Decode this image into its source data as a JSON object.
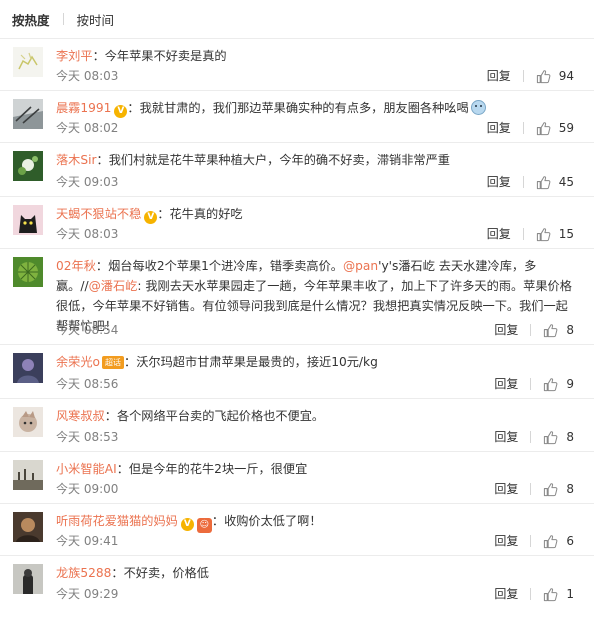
{
  "tabs": {
    "hot": "按热度",
    "time": "按时间"
  },
  "reply_label": "回复",
  "comments": [
    {
      "user": "李刘平",
      "colon": "：",
      "text": "今年苹果不好卖是真的",
      "time": "今天 08:03",
      "likes": "94"
    },
    {
      "user": "晨霧1991",
      "colon": "：",
      "text": "我就甘肃的，我们那边苹果确实种的有点多，朋友圈各种吆喝",
      "time": "今天 08:02",
      "likes": "59"
    },
    {
      "user": "落木Sir",
      "colon": "：",
      "text": "我们村就是花牛苹果种植大户，今年的确不好卖，滞销非常严重",
      "time": "今天 09:03",
      "likes": "45"
    },
    {
      "user": "天蝎不狠站不稳",
      "colon": "：",
      "text": "花牛真的好吃",
      "time": "今天 08:03",
      "likes": "15"
    },
    {
      "user": "02年秋",
      "colon": "：",
      "text_a": "烟台每收2个苹果1个进冷库，错季卖高价。",
      "mention_1": "@pan",
      "text_b": "'y's潘石屹 去天水建冷库，多赢。//",
      "mention_2": "@潘石屹",
      "text_c": ": 我刚去天水苹果园走了一趟，今年苹果丰收了，加上下了许多天的雨。苹果价格很低，今年苹果不好销售。有位领导问我到底是什么情况？我想把真实情况反映一下。我们一起帮帮忙吧！",
      "time": "今天 08:54",
      "likes": "8"
    },
    {
      "user": "余荣光o",
      "tag": "超话",
      "colon": "：",
      "text": "沃尔玛超市甘肃苹果是最贵的，接近10元/kg",
      "time": "今天 08:56",
      "likes": "9"
    },
    {
      "user": "风寒叔叔",
      "colon": "：",
      "text": "各个网络平台卖的飞起价格也不便宜。",
      "time": "今天 08:53",
      "likes": "8"
    },
    {
      "user": "小米智能AI",
      "colon": "：",
      "text": "但是今年的花牛2块一斤，很便宜",
      "time": "今天 09:00",
      "likes": "8"
    },
    {
      "user": "听雨荷花爱猫猫的妈妈",
      "colon": "：",
      "text": "收购价太低了啊！",
      "time": "今天 09:41",
      "likes": "6"
    },
    {
      "user": "龙族5288",
      "colon": "：",
      "text": "不好卖，价格低",
      "time": "今天 09:29",
      "likes": "1"
    }
  ],
  "colors": {
    "username": "#eb7350",
    "text": "#333333",
    "meta": "#808080",
    "divider": "#ececec"
  },
  "icons": {
    "like": "thumbs-up-icon",
    "verified": "verified-v-icon"
  }
}
